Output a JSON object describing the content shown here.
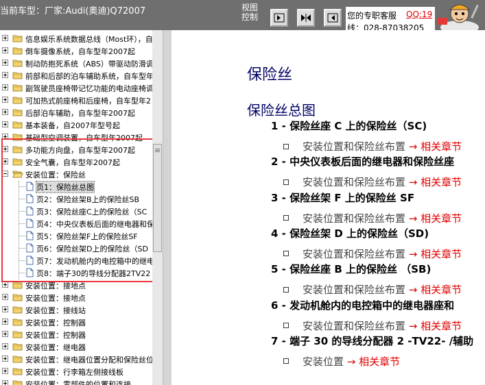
{
  "header": {
    "car_model": "当前车型：厂家:Audi(奥迪)Q72007",
    "view_control": "视图控制",
    "support_label": "您的专职客服",
    "support_qq": "QQ:19",
    "support_tel": "线：028-87038205"
  },
  "tree": {
    "rows": [
      {
        "label": "信息娱乐系统数据总线（Most环），自"
      },
      {
        "label": "倒车摄像系统，自车型年2007起"
      },
      {
        "label": "制动防抱死系统（ABS）带驱动防滑调"
      },
      {
        "label": "前部和后部的泊车辅助系统，自车型年"
      },
      {
        "label": "副驾驶员座椅带记忆功能的电动座椅调"
      },
      {
        "label": "可加热式前座椅和后座椅，自车型年2"
      },
      {
        "label": "后部泊车辅助，自车型年2007起"
      },
      {
        "label": "基本装备，自2007年型号起"
      },
      {
        "label": "基础型空调装置，自车型年2007起"
      },
      {
        "label": "多功能方向盘，自车型年2007起"
      },
      {
        "label": "安全气囊，自车型年2007起"
      },
      {
        "label": "安装位置：保险丝"
      },
      {
        "label": "页1：保险丝总图"
      },
      {
        "label": "页2：保险丝架B上的保险丝SB"
      },
      {
        "label": "页3：保险丝座C上的保险丝（SC"
      },
      {
        "label": "页4：中央仪表板后面的继电器和保"
      },
      {
        "label": "页5：保险丝架F上的保险丝SF"
      },
      {
        "label": "页6：保险丝架D上的保险丝（SD"
      },
      {
        "label": "页7：发动机舱内的电控箱中的继电"
      },
      {
        "label": "页8：端子30的导线分配器2TV22"
      },
      {
        "label": "安装位置：接地点"
      },
      {
        "label": "安装位置：接地点"
      },
      {
        "label": "安装位置：接线站"
      },
      {
        "label": "安装位置：控制器"
      },
      {
        "label": "安装位置：控制器"
      },
      {
        "label": "安装位置：继电器"
      },
      {
        "label": "安装位置：继电器位置分配和保险丝位"
      },
      {
        "label": "安装位置：行李箱左侧接线板"
      },
      {
        "label": "安装位置：零部件的位置和连接"
      }
    ]
  },
  "content": {
    "title": "保险丝",
    "section_title": "保险丝总图",
    "items": [
      {
        "title": "1 - 保险丝座 C 上的保险丝（SC)",
        "sub_text": "安装位置和保险丝布置",
        "sub_link": "→ 相关章节"
      },
      {
        "title": "2 - 中央仪表板后面的继电器和保险丝座",
        "sub_text": "安装位置和保险丝布置",
        "sub_link": "→ 相关章节"
      },
      {
        "title": "3 - 保险丝架 F 上的保险丝 SF",
        "sub_text": "安装位置和保险丝布置",
        "sub_link": "→ 相关章节"
      },
      {
        "title": "4 - 保险丝架 D 上的保险丝（SD)",
        "sub_text": "安装位置和保险丝布置",
        "sub_link": "→ 相关章节"
      },
      {
        "title": "5 - 保险丝座 B 上的保险丝 （SB)",
        "sub_text": "安装位置和保险丝布置",
        "sub_link": "→ 相关章节"
      },
      {
        "title": "6 - 发动机舱内的电控箱中的继电器座和",
        "sub_text": "安装位置和保险丝布置",
        "sub_link": "→ 相关章节"
      },
      {
        "title": "7 - 端子 30 的导线分配器 2 -TV22- /辅助",
        "sub_text": "安装位置",
        "sub_link": "→ 相关章节"
      }
    ]
  }
}
